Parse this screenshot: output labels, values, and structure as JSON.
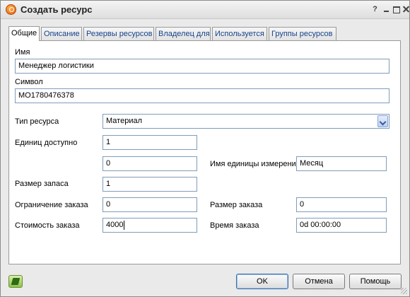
{
  "window": {
    "title": "Создать ресурс",
    "accent": "#e8580c"
  },
  "tabs": [
    {
      "label": "Общие",
      "active": true
    },
    {
      "label": "Описание",
      "active": false
    },
    {
      "label": "Резервы ресурсов",
      "active": false
    },
    {
      "label": "Владелец для",
      "active": false
    },
    {
      "label": "Используется",
      "active": false
    },
    {
      "label": "Группы ресурсов",
      "active": false
    }
  ],
  "form": {
    "name": {
      "label": "Имя",
      "value": "Менеджер логистики"
    },
    "symbol": {
      "label": "Символ",
      "value": "MO1780476378"
    },
    "resource_type": {
      "label": "Тип ресурса",
      "value": "Материал"
    },
    "units_available": {
      "label": "Единиц доступно",
      "value": "1",
      "value2": "0"
    },
    "unit_name": {
      "label": "Имя единицы измерения",
      "value": "Месяц"
    },
    "stock_size": {
      "label": "Размер запаса",
      "value": "1"
    },
    "order_limit": {
      "label": "Ограничение заказа",
      "value": "0"
    },
    "order_size": {
      "label": "Размер заказа",
      "value": "0"
    },
    "order_cost": {
      "label": "Стоимость заказа",
      "value": "4000"
    },
    "order_time": {
      "label": "Время заказа",
      "value": "0d 00:00:00"
    }
  },
  "buttons": {
    "ok": "OK",
    "cancel": "Отмена",
    "help": "Помощь"
  },
  "icons": {
    "app": "app-logo-icon",
    "footer": "book-icon"
  }
}
